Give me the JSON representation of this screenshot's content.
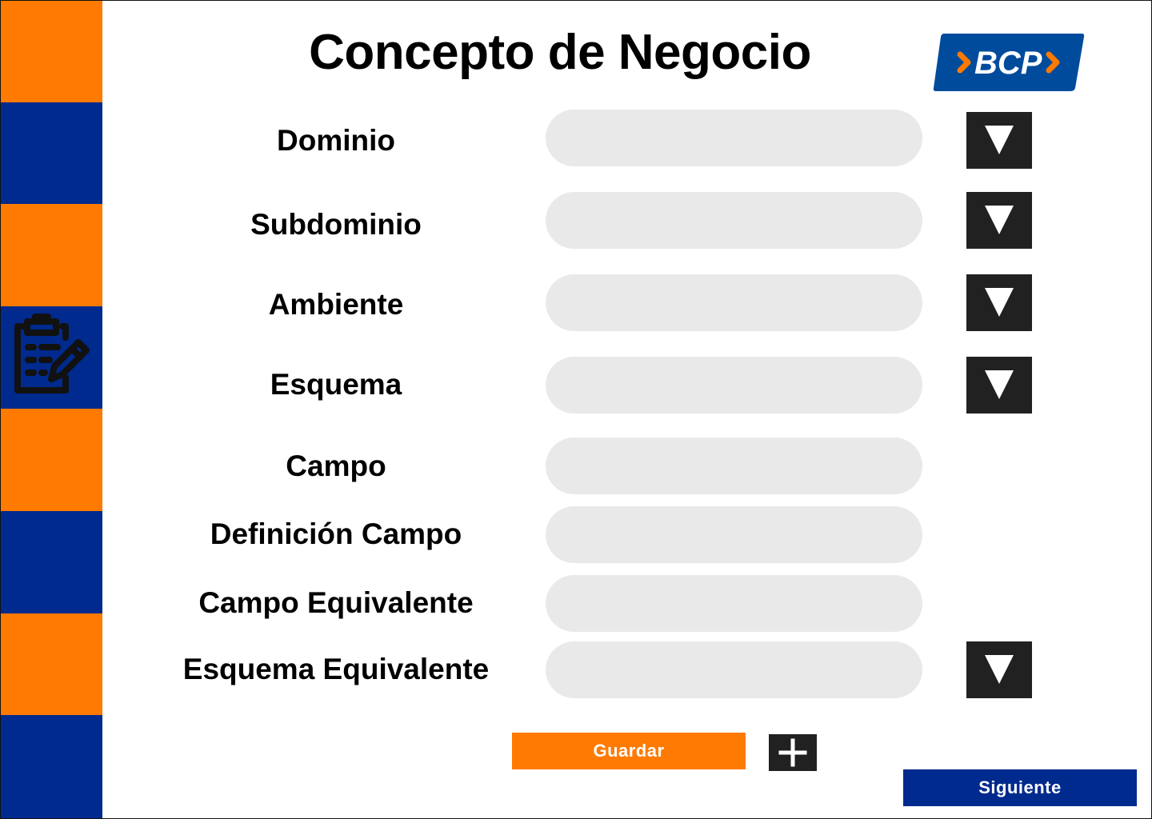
{
  "page": {
    "title": "Concepto de Negocio"
  },
  "logo": {
    "text": "BCP",
    "background_color": "#004B9C",
    "chevron_color": "#FF7A00"
  },
  "sidebar": {
    "stripe_colors": [
      "#FF7A00",
      "#002A8D"
    ],
    "icon": "clipboard-edit-icon"
  },
  "form": {
    "fields": [
      {
        "label": "Dominio",
        "value": "",
        "has_dropdown": true
      },
      {
        "label": "Subdominio",
        "value": "",
        "has_dropdown": true
      },
      {
        "label": "Ambiente",
        "value": "",
        "has_dropdown": true
      },
      {
        "label": "Esquema",
        "value": "",
        "has_dropdown": true
      },
      {
        "label": "Campo",
        "value": "",
        "has_dropdown": false
      },
      {
        "label": "Definición Campo",
        "value": "",
        "has_dropdown": false
      },
      {
        "label": "Campo Equivalente",
        "value": "",
        "has_dropdown": false
      },
      {
        "label": "Esquema Equivalente",
        "value": "",
        "has_dropdown": true
      }
    ],
    "dropdown_icon": "triangle-down-icon"
  },
  "actions": {
    "save_label": "Guardar",
    "add_icon": "plus-icon",
    "next_label": "Siguiente"
  },
  "colors": {
    "orange": "#FF7A00",
    "blue": "#002A8D",
    "field_bg": "#E9E9E9",
    "dark_button": "#212121"
  }
}
